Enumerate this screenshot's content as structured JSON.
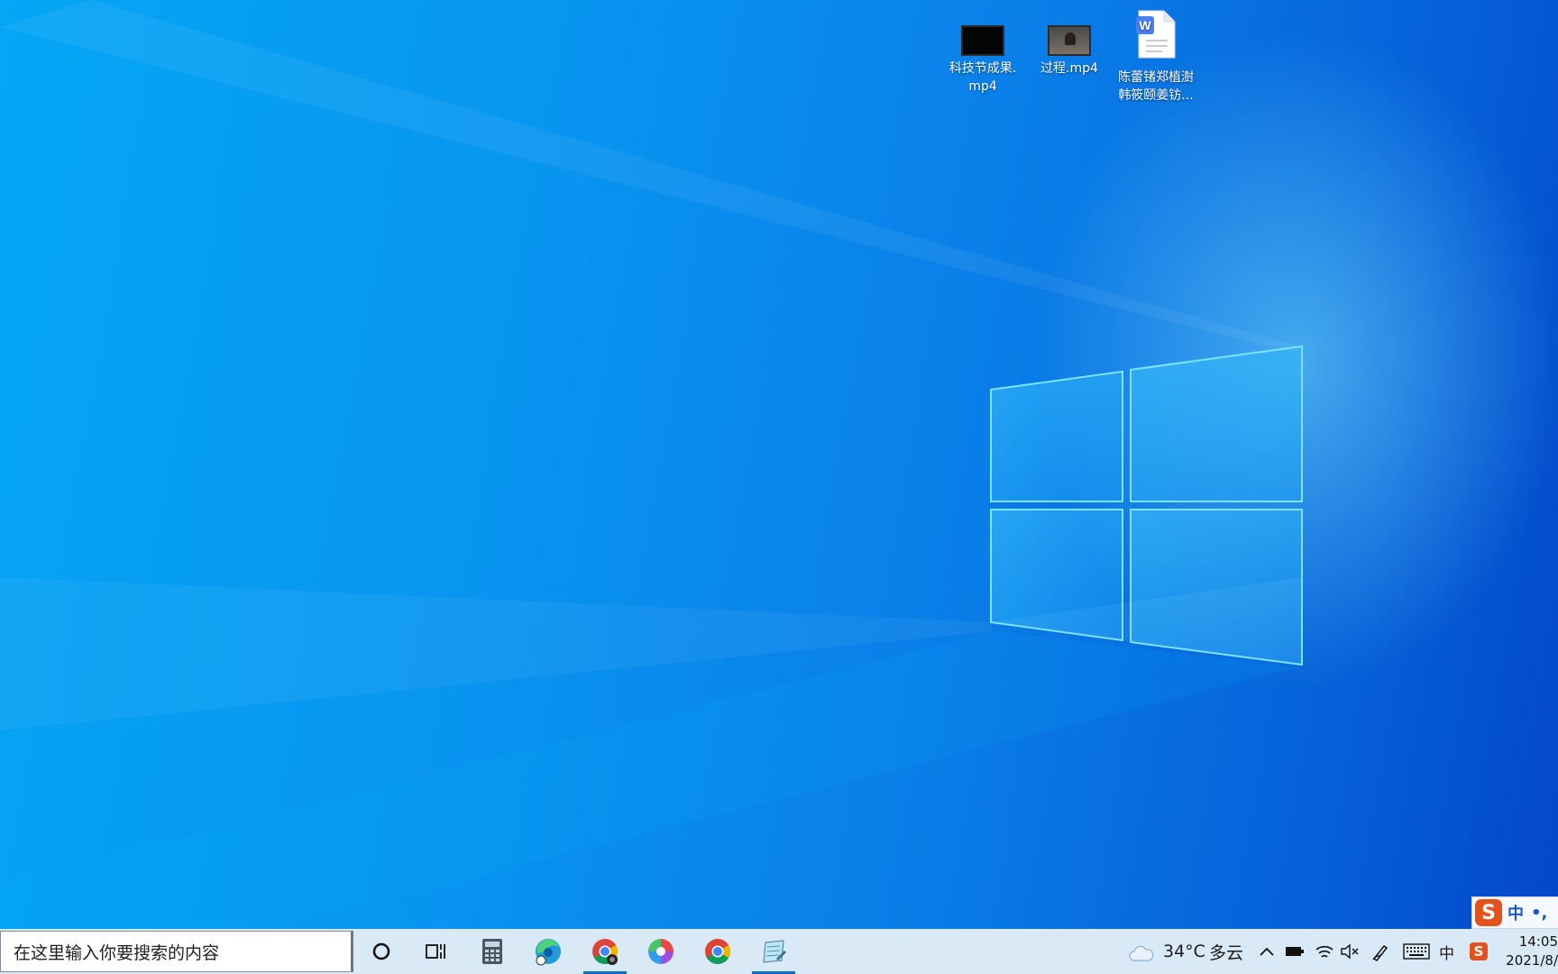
{
  "desktop": {
    "icons": [
      {
        "label": "科技节成果.mp4",
        "icon": "video-thumbnail-icon"
      },
      {
        "label": "过程.mp4",
        "icon": "video-thumbnail-icon"
      },
      {
        "label": "陈蕾锗郑植澍韩筱颐姜钫...",
        "icon": "wps-word-document-icon"
      }
    ]
  },
  "ime": {
    "lang_label": "中",
    "punct_label": "•,",
    "icon": "sogou-ime-icon"
  },
  "taskbar": {
    "search_placeholder": "在这里输入你要搜索的内容",
    "pinned": [
      {
        "name": "cortana",
        "icon": "cortana-circle-icon"
      },
      {
        "name": "task-view",
        "icon": "task-view-icon"
      },
      {
        "name": "calculator",
        "icon": "calculator-icon"
      },
      {
        "name": "edge",
        "icon": "edge-icon"
      },
      {
        "name": "chrome-profile",
        "icon": "chrome-icon",
        "active": true
      },
      {
        "name": "photos",
        "icon": "pinwheel-icon"
      },
      {
        "name": "chrome",
        "icon": "chrome-icon"
      },
      {
        "name": "notes",
        "icon": "notepad-icon",
        "active": true
      }
    ],
    "weather": {
      "temp": "34°C",
      "condition": "多云",
      "icon": "cloud-icon"
    },
    "tray": {
      "ime_lang": "中",
      "icons": [
        "chevron-up-icon",
        "battery-icon",
        "wifi-icon",
        "volume-muted-icon",
        "pen-icon",
        "keyboard-icon",
        "sogou-tray-icon"
      ]
    },
    "clock": {
      "time": "14:05",
      "date": "2021/8/"
    }
  },
  "colors": {
    "taskbar_bg": "#d9e9f5",
    "accent": "#0b6fc4",
    "sogou_orange": "#e2521d"
  }
}
